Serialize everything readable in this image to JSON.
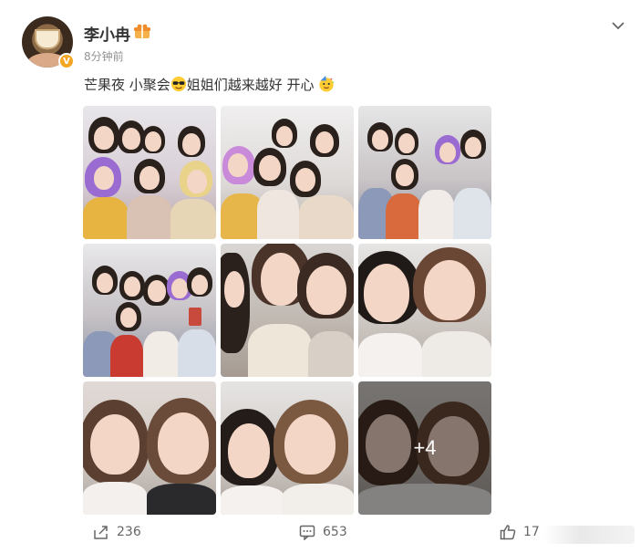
{
  "post": {
    "username": "李小冉",
    "timestamp": "8分钟前",
    "text": "芒果夜 小聚会",
    "text_after_emoji": "姐姐们越来越好 开心",
    "more_photos_label": "+4"
  },
  "actions": {
    "share_count": "236",
    "comment_count": "653",
    "like_count": "17"
  },
  "icons": {
    "user_badge": "gift-badge-icon",
    "verified": "verified-v-icon",
    "menu": "chevron-down-icon",
    "emoji_1": "sunglasses-emoji",
    "emoji_2": "partying-face-emoji",
    "share": "share-icon",
    "comment": "comment-icon",
    "like": "thumbs-up-icon"
  },
  "colors": {
    "accent": "#f5a623",
    "text_main": "#333333",
    "text_muted": "#939393"
  },
  "photos": [
    {
      "label": "group-photo-1"
    },
    {
      "label": "group-photo-2"
    },
    {
      "label": "group-photo-3"
    },
    {
      "label": "group-photo-4"
    },
    {
      "label": "selfie-1"
    },
    {
      "label": "selfie-2"
    },
    {
      "label": "selfie-3"
    },
    {
      "label": "selfie-4"
    },
    {
      "label": "selfie-5"
    }
  ]
}
